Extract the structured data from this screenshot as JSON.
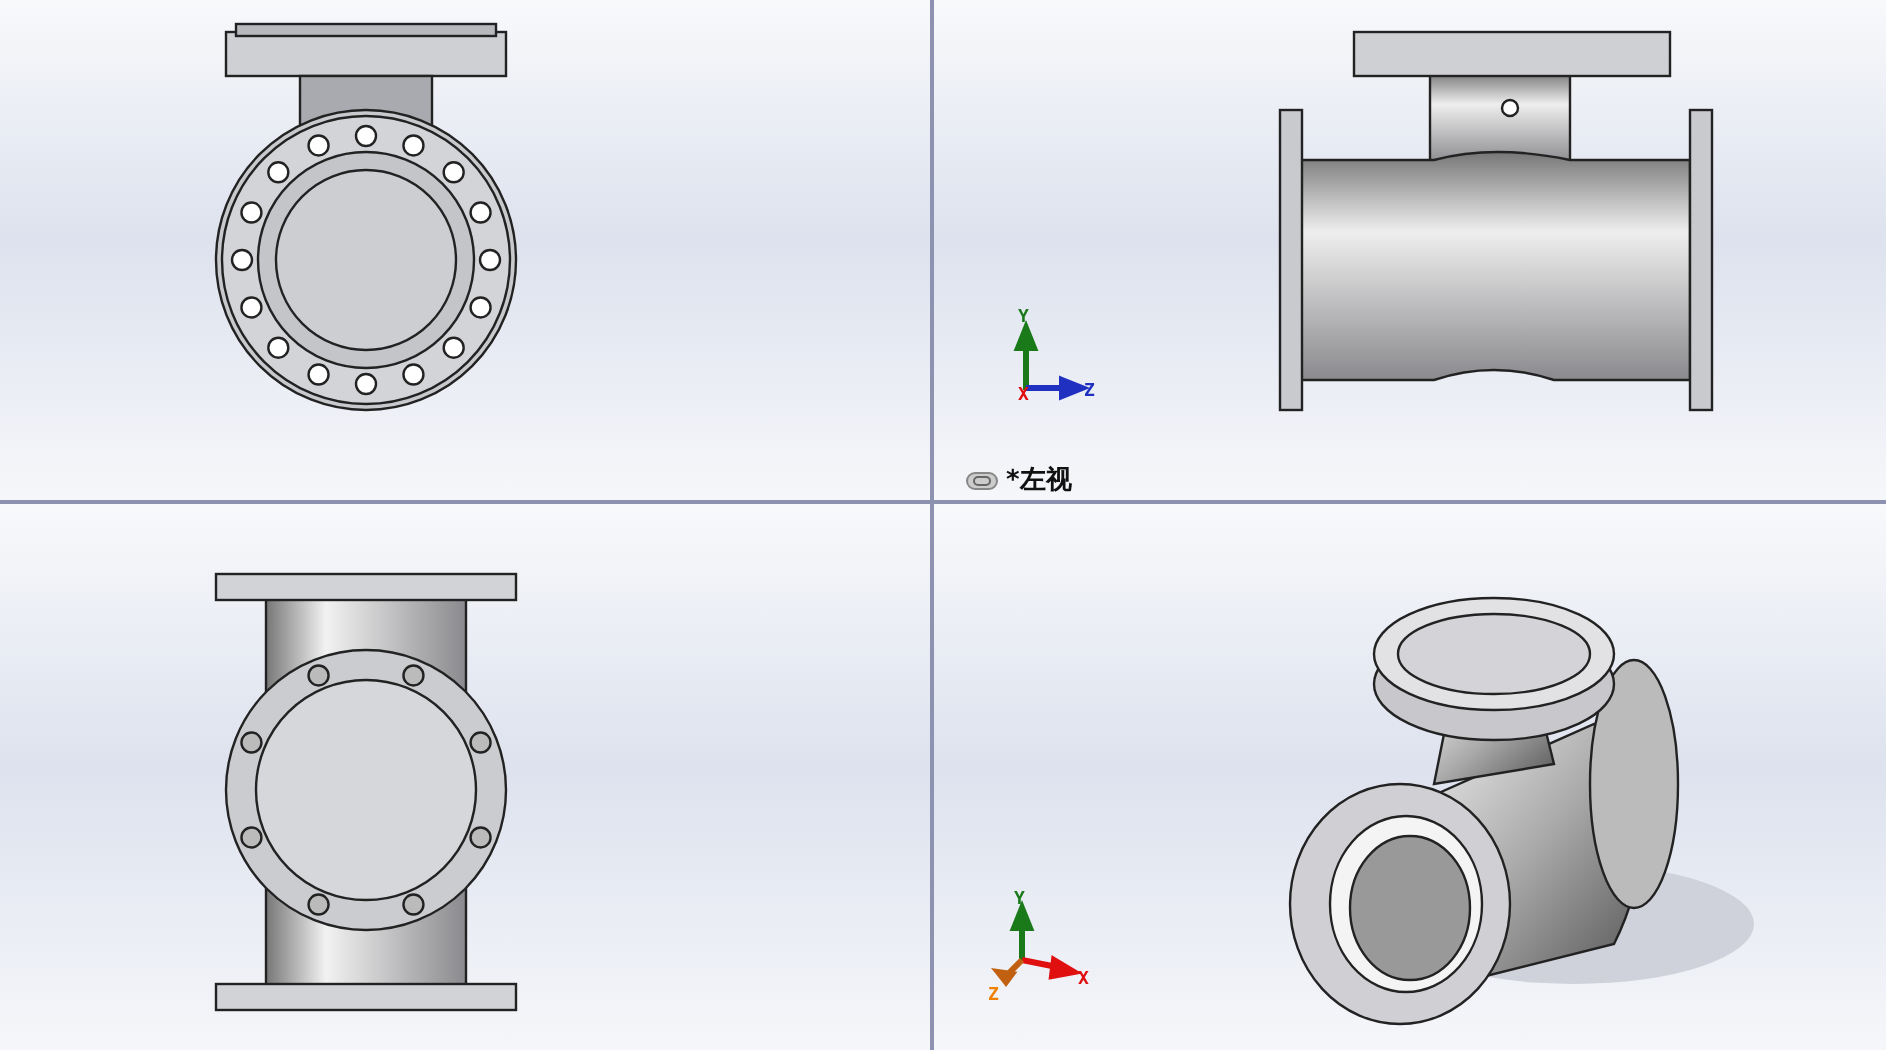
{
  "viewports": [
    {
      "kind": "front"
    },
    {
      "kind": "left",
      "triad": {
        "kind": "planar",
        "axes": [
          {
            "label": "Y"
          },
          {
            "label": "X"
          },
          {
            "label": "Z"
          }
        ]
      },
      "view_label": {
        "linked": true,
        "text": "*左视"
      }
    },
    {
      "kind": "top"
    },
    {
      "kind": "iso",
      "triad": {
        "kind": "iso",
        "axes": [
          {
            "label": "Y"
          },
          {
            "label": "Z"
          },
          {
            "label": "X"
          }
        ]
      }
    }
  ]
}
